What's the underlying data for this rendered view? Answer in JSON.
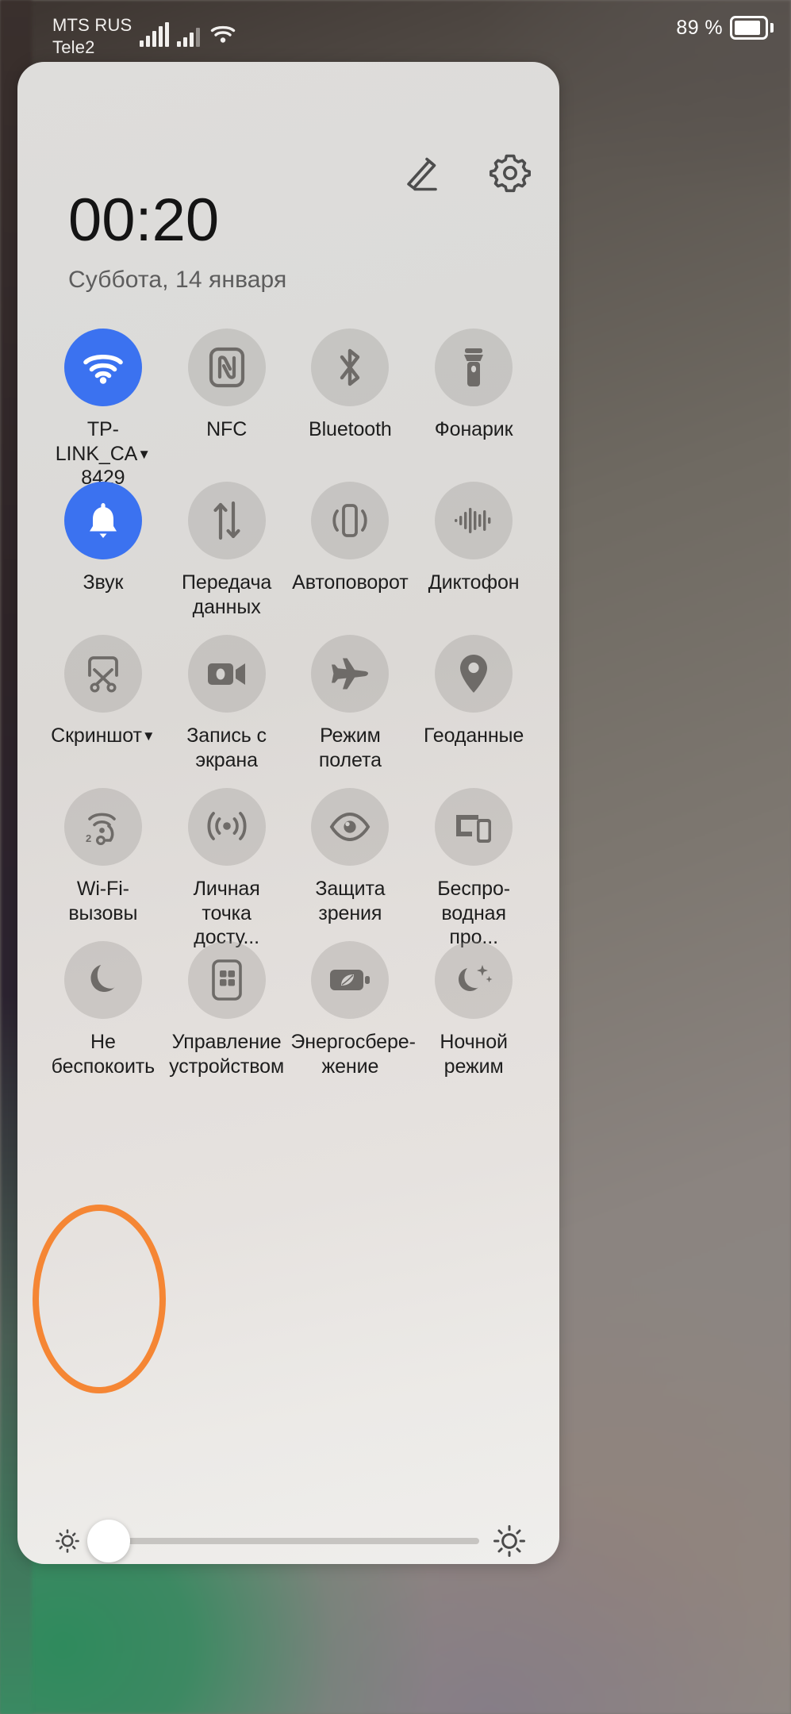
{
  "status_bar": {
    "carrier_line1": "MTS RUS",
    "carrier_line2": "Tele2",
    "signal_icon_1": "signal-bars-icon",
    "signal_icon_2": "signal-bars-icon",
    "wifi_icon": "wifi-icon",
    "battery_percent": "89 %",
    "battery_icon": "battery-icon",
    "battery_level": 89
  },
  "panel": {
    "edit_icon": "pencil-edit-icon",
    "settings_icon": "gear-icon",
    "clock_time": "00:20",
    "clock_date": "Суббота, 14 января",
    "collapse_handle_icon": "chevron-up-icon"
  },
  "tiles": [
    {
      "label": "TP-LINK_CA\n8429",
      "label_line1": "TP-LINK_CA",
      "label_line2": "8429",
      "icon": "wifi-icon",
      "active": true,
      "has_caret": true,
      "name": "wifi"
    },
    {
      "label": "NFC",
      "icon": "nfc-icon",
      "active": false,
      "has_caret": false,
      "name": "nfc"
    },
    {
      "label": "Bluetooth",
      "icon": "bluetooth-icon",
      "active": false,
      "has_caret": false,
      "name": "bluetooth"
    },
    {
      "label": "Фонарик",
      "icon": "flashlight-icon",
      "active": false,
      "has_caret": false,
      "name": "flashlight"
    },
    {
      "label": "Звук",
      "icon": "bell-sound-icon",
      "active": true,
      "has_caret": false,
      "name": "sound"
    },
    {
      "label": "Передача\nданных",
      "icon": "mobile-data-arrows-icon",
      "active": false,
      "has_caret": false,
      "name": "mobile-data"
    },
    {
      "label": "Автоповорот",
      "icon": "auto-rotate-icon",
      "active": false,
      "has_caret": false,
      "name": "auto-rotate"
    },
    {
      "label": "Диктофон",
      "icon": "voice-recorder-icon",
      "active": false,
      "has_caret": false,
      "name": "voice-recorder"
    },
    {
      "label": "Скриншот",
      "icon": "screenshot-scissors-icon",
      "active": false,
      "has_caret": true,
      "name": "screenshot"
    },
    {
      "label": "Запись с\nэкрана",
      "icon": "screen-record-camera-icon",
      "active": false,
      "has_caret": false,
      "name": "screen-record"
    },
    {
      "label": "Режим\nполета",
      "icon": "airplane-icon",
      "active": false,
      "has_caret": false,
      "name": "airplane-mode"
    },
    {
      "label": "Геоданные",
      "icon": "location-pin-icon",
      "active": false,
      "has_caret": false,
      "name": "location"
    },
    {
      "label": "Wi-Fi-вызовы",
      "icon": "wifi-calling-icon",
      "active": false,
      "has_caret": false,
      "name": "wifi-calling"
    },
    {
      "label": "Личная\nточка досту...",
      "icon": "hotspot-icon",
      "active": false,
      "has_caret": false,
      "name": "hotspot"
    },
    {
      "label": "Защита\nзрения",
      "icon": "eye-comfort-icon",
      "active": false,
      "has_caret": false,
      "name": "eye-comfort"
    },
    {
      "label": "Беспро-\nводная про...",
      "icon": "wireless-projection-icon",
      "active": false,
      "has_caret": false,
      "name": "wireless-projection"
    },
    {
      "label": "Не\nбеспокоить",
      "icon": "moon-crescent-icon",
      "active": false,
      "has_caret": false,
      "name": "do-not-disturb"
    },
    {
      "label": "Управление\nустройством",
      "icon": "device-control-icon",
      "active": false,
      "has_caret": false,
      "name": "device-control"
    },
    {
      "label": "Энергосбере-\nжение",
      "icon": "battery-saver-leaf-icon",
      "active": false,
      "has_caret": false,
      "name": "power-saving"
    },
    {
      "label": "Ночной\nрежим",
      "icon": "night-mode-moon-stars-icon",
      "active": false,
      "has_caret": false,
      "name": "night-mode"
    }
  ],
  "brightness": {
    "low_icon": "brightness-low-sun-icon",
    "high_icon": "brightness-high-sun-icon",
    "value_percent": 4
  },
  "annotation": {
    "shape": "ellipse",
    "color": "#f58634",
    "target_tile": "do-not-disturb"
  },
  "colors": {
    "accent_active": "#3b72f0",
    "tile_inactive": "rgba(150,147,143,0.30)",
    "panel_bg": "#dedddb",
    "text_primary": "#1d1d1d",
    "text_secondary": "#5d5d5d",
    "annotation": "#f58634"
  }
}
